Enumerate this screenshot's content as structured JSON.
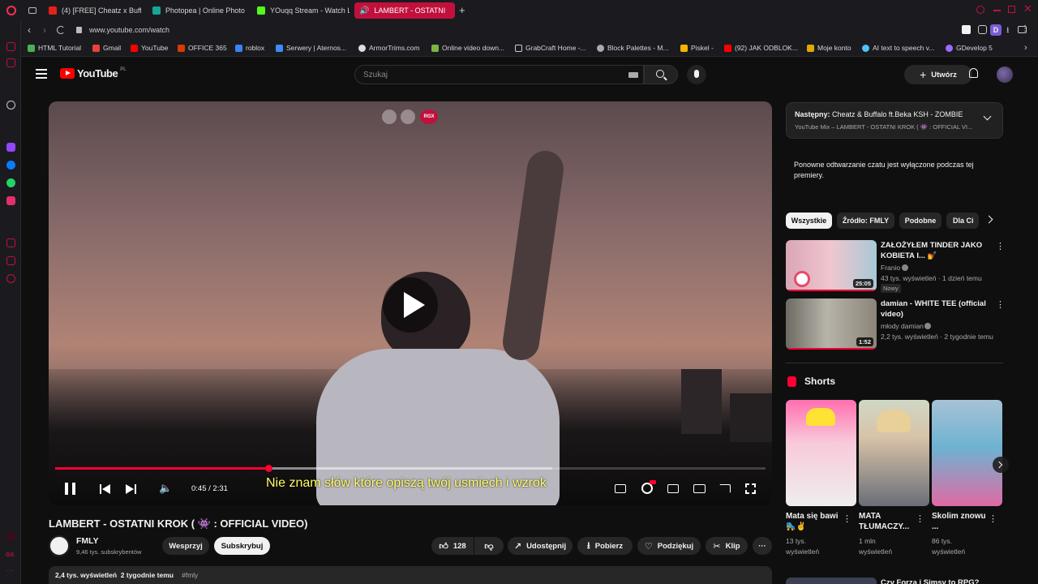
{
  "tabs": [
    {
      "label": "(4) [FREE] Cheatz x Buffa",
      "color": "#e62117"
    },
    {
      "label": "Photopea | Online Photo E",
      "color": "#18a497"
    },
    {
      "label": "YOuqq Stream - Watch Li",
      "color": "#53fc18"
    },
    {
      "label": "LAMBERT - OSTATNI",
      "color": "#ffffff"
    }
  ],
  "url": "www.youtube.com/watch",
  "bookmarks": [
    {
      "label": "HTML Tutorial",
      "color": "#4caf50"
    },
    {
      "label": "Gmail",
      "color": "#ea4335"
    },
    {
      "label": "YouTube",
      "color": "#ff0000"
    },
    {
      "label": "OFFICE 365",
      "color": "#d83b01"
    },
    {
      "label": "roblox",
      "color": "#3b82f6"
    },
    {
      "label": "Serwery | Aternos...",
      "color": "#3d8bfd"
    },
    {
      "label": "ArmorTrims.com",
      "color": "#dddddd"
    },
    {
      "label": "Online video down...",
      "color": "#7cb342"
    },
    {
      "label": "GrabCraft Home -...",
      "color": "#cccccc"
    },
    {
      "label": "Block Palettes - M...",
      "color": "#aaaaaa"
    },
    {
      "label": "Piskel -",
      "color": "#f4b400"
    },
    {
      "label": "(92) JAK ODBLOK...",
      "color": "#ff0000"
    },
    {
      "label": "Moje konto",
      "color": "#e0a800"
    },
    {
      "label": "AI text to speech v...",
      "color": "#4fc3f7"
    },
    {
      "label": "GDevelop 5",
      "color": "#9c6bff"
    }
  ],
  "profile_initial": "D",
  "yt": {
    "logo_text": "YouTube",
    "region": "PL",
    "search_placeholder": "Szukaj",
    "create_label": "Utwórz",
    "overlay_badge": "RGX",
    "player": {
      "time": "0:45 / 2:31",
      "subtitle": "Nie znam słów które opiszą twój usmiech i wzrok",
      "progress": 0.3,
      "buffered": 0.7
    },
    "video_title": "LAMBERT - OSTATNI KROK ( 👾 : OFFICIAL VIDEO)",
    "channel": {
      "name": "FMLY",
      "subs": "9,46 tys. subskrybentów"
    },
    "support_label": "Wesprzyj",
    "subscribe_label": "Subskrybuj",
    "likes": "128",
    "share_label": "Udostępnij",
    "download_label": "Pobierz",
    "thanks_label": "Podziękuj",
    "clip_label": "Klip",
    "description_meta": "2,4 tys. wyświetleń  2 tygodnie temu",
    "description_tag": "#fmly",
    "next": {
      "label": "Następny:",
      "title": "Cheatz & Buffalo ft.Beka KSH - ZOMBIE",
      "mix": "YouTube Mix – LAMBERT - OSTATNI KROK ( 👾 : OFFICIAL VI..."
    },
    "chat_note": "Ponowne odtwarzanie czatu jest wyłączone podczas tej premiery.",
    "chips": [
      "Wszystkie",
      "Źródło: FMLY",
      "Podobne",
      "Dla Ci"
    ],
    "recommended": [
      {
        "title": "ZAŁOŻYŁEM TINDER JAKO KOBIETA I... 💅",
        "channel": "Franio",
        "meta": "43 tys. wyświetleń · 1 dzień temu",
        "badge": "Nowy",
        "duration": "25:05"
      },
      {
        "title": "damian - WHITE TEE (official video)",
        "channel": "młody damian",
        "meta": "2,2 tys. wyświetleń · 2 tygodnie temu",
        "duration": "1:52"
      }
    ],
    "shorts_label": "Shorts",
    "shorts": [
      {
        "title": "Mata się bawi🛼✌️",
        "views": "13 tys. wyświetleń"
      },
      {
        "title": "MATA TŁUMACZY...",
        "views": "1 mln wyświetleń"
      },
      {
        "title": "Skolim znowu ...",
        "views": "86 tys. wyświetleń"
      }
    ],
    "next_row_title": "Czy Forza i Simsy to RPG?"
  }
}
